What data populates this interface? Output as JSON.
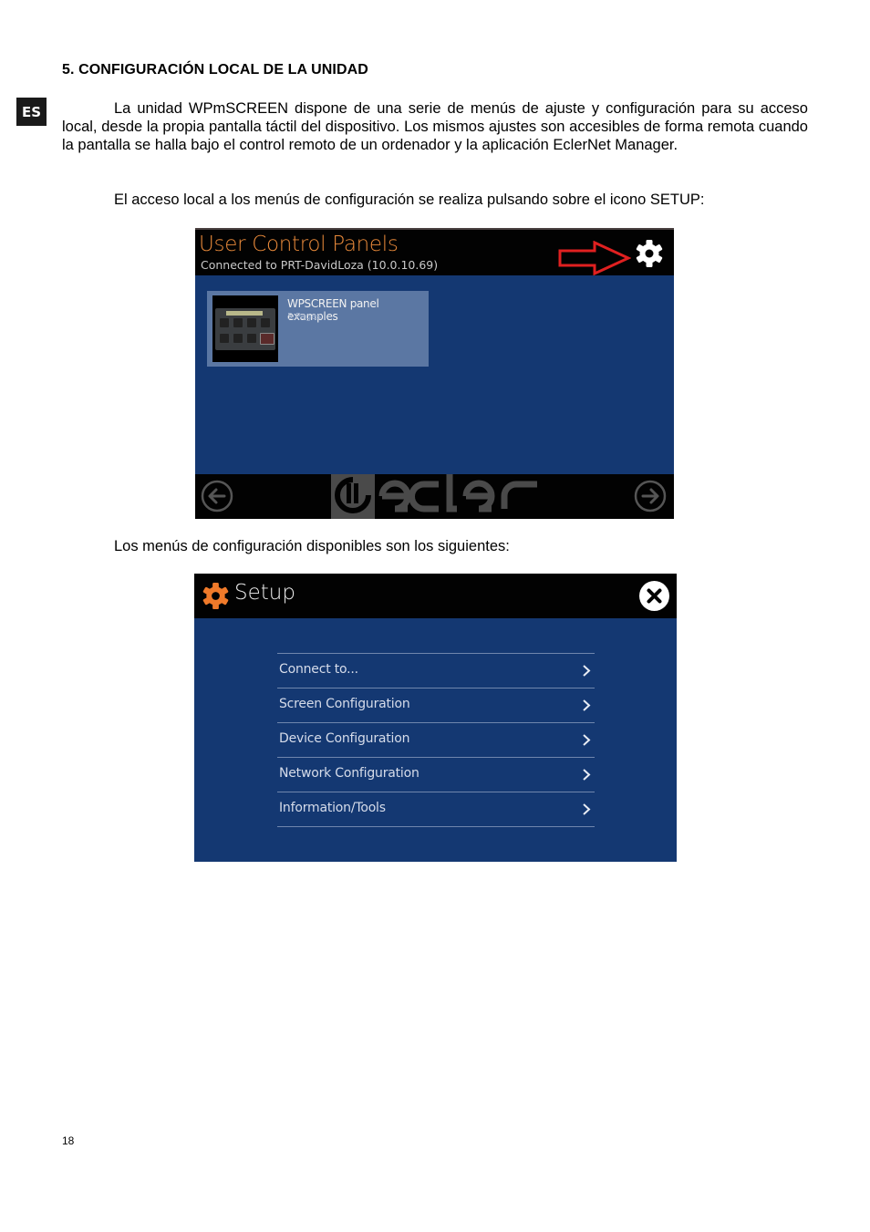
{
  "document": {
    "heading": "5. CONFIGURACIÓN LOCAL DE LA UNIDAD",
    "language_badge": "ES",
    "paragraph_1": "La unidad WPmSCREEN dispone de una serie de menús de ajuste y configuración para su acceso local, desde la propia pantalla táctil del dispositivo. Los mismos ajustes son accesibles de forma remota cuando la pantalla se halla bajo el control remoto de un ordenador y la aplicación EclerNet Manager.",
    "paragraph_2": "El acceso local a los menús de configuración se realiza pulsando sobre el icono SETUP:",
    "paragraph_3": "Los menús de configuración disponibles son los siguientes:",
    "page_number": "18"
  },
  "screenshot_panels": {
    "title": "User Control Panels",
    "subtitle": "Connected to PRT-DavidLoza (10.0.10.69)",
    "setup_icon": "gear-icon",
    "pointer_icon": "red-arrow-right-icon",
    "card": {
      "title": "WPSCREEN panel examples",
      "subtitle": "5 Pages",
      "thumbnail_label": "PRESET SELECTOR"
    },
    "footer": {
      "prev_icon": "arrow-left-circle-icon",
      "next_icon": "arrow-right-circle-icon",
      "logo": "ecler"
    },
    "colors": {
      "title": "#e8893a",
      "background": "#143872",
      "card": "#5b77a3",
      "arrow": "#e02020"
    }
  },
  "screenshot_setup": {
    "title": "Setup",
    "icon": "gear-icon",
    "close_icon": "close-icon",
    "menu": [
      {
        "label": "Connect to..."
      },
      {
        "label": "Screen Configuration"
      },
      {
        "label": "Device Configuration"
      },
      {
        "label": "Network Configuration"
      },
      {
        "label": "Information/Tools"
      }
    ],
    "colors": {
      "gear": "#f07a2a",
      "background": "#143872"
    }
  }
}
